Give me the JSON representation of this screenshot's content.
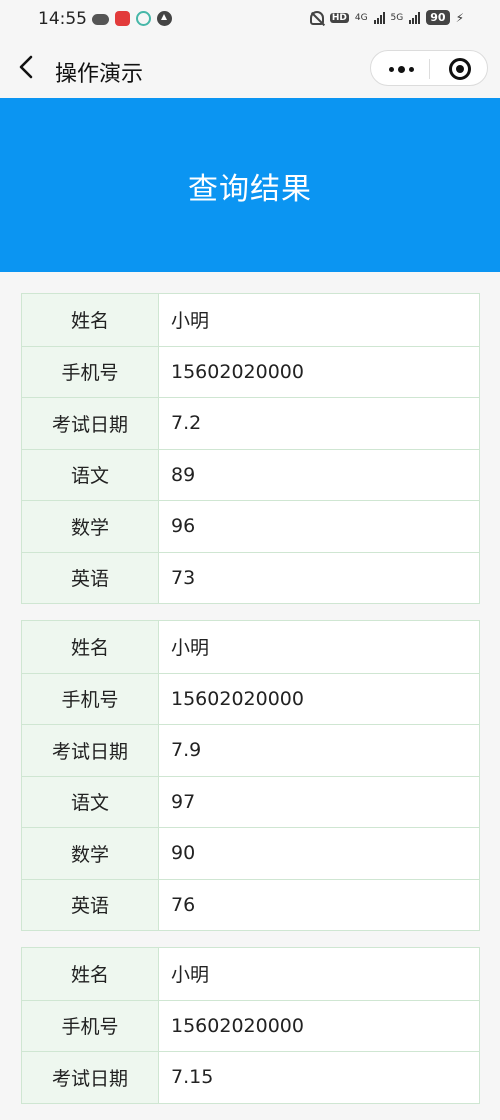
{
  "status_bar": {
    "time": "14:55",
    "hd": "HD",
    "net1": "4G",
    "net2": "5G",
    "battery": "90"
  },
  "nav": {
    "title": "操作演示"
  },
  "banner": {
    "title": "查询结果"
  },
  "colors": {
    "banner": "#0b95f2",
    "label_bg": "#eef7ef",
    "border": "#cfe6d2"
  },
  "records": [
    {
      "rows": [
        {
          "label": "姓名",
          "value": "小明"
        },
        {
          "label": "手机号",
          "value": "15602020000"
        },
        {
          "label": "考试日期",
          "value": "7.2"
        },
        {
          "label": "语文",
          "value": "89"
        },
        {
          "label": "数学",
          "value": "96"
        },
        {
          "label": "英语",
          "value": "73"
        }
      ]
    },
    {
      "rows": [
        {
          "label": "姓名",
          "value": "小明"
        },
        {
          "label": "手机号",
          "value": "15602020000"
        },
        {
          "label": "考试日期",
          "value": "7.9"
        },
        {
          "label": "语文",
          "value": "97"
        },
        {
          "label": "数学",
          "value": "90"
        },
        {
          "label": "英语",
          "value": "76"
        }
      ]
    },
    {
      "rows": [
        {
          "label": "姓名",
          "value": "小明"
        },
        {
          "label": "手机号",
          "value": "15602020000"
        },
        {
          "label": "考试日期",
          "value": "7.15"
        }
      ]
    }
  ]
}
